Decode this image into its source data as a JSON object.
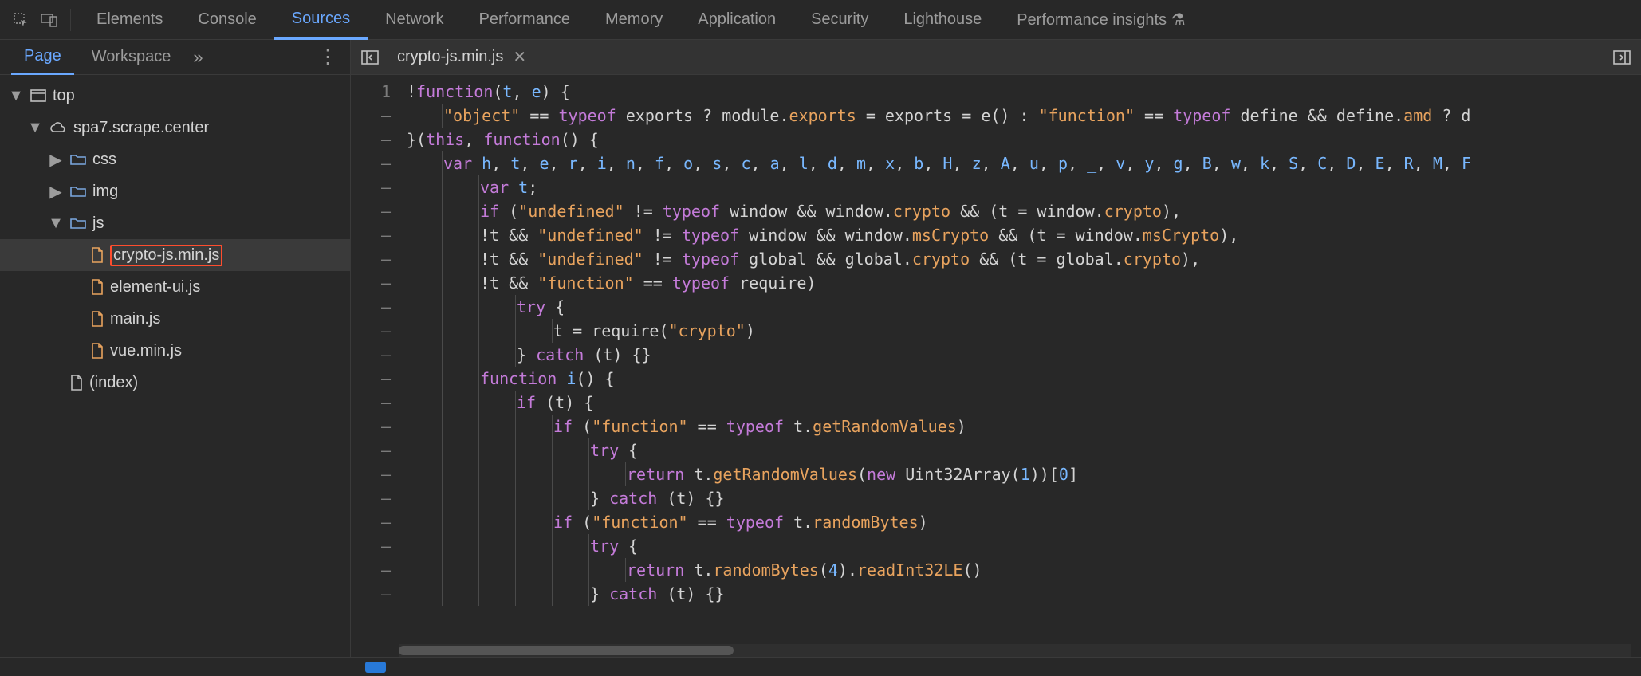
{
  "toolbar": {
    "tabs": [
      "Elements",
      "Console",
      "Sources",
      "Network",
      "Performance",
      "Memory",
      "Application",
      "Security",
      "Lighthouse",
      "Performance insights ⚗"
    ],
    "active_index": 2
  },
  "left_panel": {
    "subtabs": [
      "Page",
      "Workspace"
    ],
    "active_index": 0
  },
  "open_file_tab": "crypto-js.min.js",
  "tree": {
    "root": "top",
    "domain": "spa7.scrape.center",
    "folders": [
      {
        "name": "css",
        "open": false
      },
      {
        "name": "img",
        "open": false
      },
      {
        "name": "js",
        "open": true,
        "files": [
          "crypto-js.min.js",
          "element-ui.js",
          "main.js",
          "vue.min.js"
        ]
      }
    ],
    "index_label": "(index)",
    "selected_file": "crypto-js.min.js"
  },
  "gutter": [
    "1",
    "–",
    "–",
    "–",
    "–",
    "–",
    "–",
    "–",
    "–",
    "–",
    "–",
    "–",
    "–",
    "–",
    "–",
    "–",
    "–",
    "–",
    "–",
    "–",
    "–",
    "–"
  ],
  "code_lines": [
    {
      "indent": 0,
      "tokens": [
        [
          "op",
          "!"
        ],
        [
          "kw",
          "function"
        ],
        [
          "p",
          "("
        ],
        [
          "def",
          "t"
        ],
        [
          "p",
          ", "
        ],
        [
          "def",
          "e"
        ],
        [
          "p",
          ") {"
        ]
      ]
    },
    {
      "indent": 1,
      "tokens": [
        [
          "str",
          "\"object\""
        ],
        [
          "p",
          " == "
        ],
        [
          "kw",
          "typeof"
        ],
        [
          "p",
          " exports ? module."
        ],
        [
          "prop",
          "exports"
        ],
        [
          "p",
          " = exports = e() : "
        ],
        [
          "str",
          "\"function\""
        ],
        [
          "p",
          " == "
        ],
        [
          "kw",
          "typeof"
        ],
        [
          "p",
          " define && define."
        ],
        [
          "prop",
          "amd"
        ],
        [
          "p",
          " ? d"
        ]
      ]
    },
    {
      "indent": 0,
      "tokens": [
        [
          "p",
          "}("
        ],
        [
          "kw",
          "this"
        ],
        [
          "p",
          ", "
        ],
        [
          "kw",
          "function"
        ],
        [
          "p",
          "() {"
        ]
      ]
    },
    {
      "indent": 1,
      "tokens": [
        [
          "kw",
          "var"
        ],
        [
          "p",
          " "
        ],
        [
          "def",
          "h"
        ],
        [
          "p",
          ", "
        ],
        [
          "def",
          "t"
        ],
        [
          "p",
          ", "
        ],
        [
          "def",
          "e"
        ],
        [
          "p",
          ", "
        ],
        [
          "def",
          "r"
        ],
        [
          "p",
          ", "
        ],
        [
          "def",
          "i"
        ],
        [
          "p",
          ", "
        ],
        [
          "def",
          "n"
        ],
        [
          "p",
          ", "
        ],
        [
          "def",
          "f"
        ],
        [
          "p",
          ", "
        ],
        [
          "def",
          "o"
        ],
        [
          "p",
          ", "
        ],
        [
          "def",
          "s"
        ],
        [
          "p",
          ", "
        ],
        [
          "def",
          "c"
        ],
        [
          "p",
          ", "
        ],
        [
          "def",
          "a"
        ],
        [
          "p",
          ", "
        ],
        [
          "def",
          "l"
        ],
        [
          "p",
          ", "
        ],
        [
          "def",
          "d"
        ],
        [
          "p",
          ", "
        ],
        [
          "def",
          "m"
        ],
        [
          "p",
          ", "
        ],
        [
          "def",
          "x"
        ],
        [
          "p",
          ", "
        ],
        [
          "def",
          "b"
        ],
        [
          "p",
          ", "
        ],
        [
          "def",
          "H"
        ],
        [
          "p",
          ", "
        ],
        [
          "def",
          "z"
        ],
        [
          "p",
          ", "
        ],
        [
          "def",
          "A"
        ],
        [
          "p",
          ", "
        ],
        [
          "def",
          "u"
        ],
        [
          "p",
          ", "
        ],
        [
          "def",
          "p"
        ],
        [
          "p",
          ", "
        ],
        [
          "def",
          "_"
        ],
        [
          "p",
          ", "
        ],
        [
          "def",
          "v"
        ],
        [
          "p",
          ", "
        ],
        [
          "def",
          "y"
        ],
        [
          "p",
          ", "
        ],
        [
          "def",
          "g"
        ],
        [
          "p",
          ", "
        ],
        [
          "def",
          "B"
        ],
        [
          "p",
          ", "
        ],
        [
          "def",
          "w"
        ],
        [
          "p",
          ", "
        ],
        [
          "def",
          "k"
        ],
        [
          "p",
          ", "
        ],
        [
          "def",
          "S"
        ],
        [
          "p",
          ", "
        ],
        [
          "def",
          "C"
        ],
        [
          "p",
          ", "
        ],
        [
          "def",
          "D"
        ],
        [
          "p",
          ", "
        ],
        [
          "def",
          "E"
        ],
        [
          "p",
          ", "
        ],
        [
          "def",
          "R"
        ],
        [
          "p",
          ", "
        ],
        [
          "def",
          "M"
        ],
        [
          "p",
          ", "
        ],
        [
          "def",
          "F"
        ]
      ]
    },
    {
      "indent": 2,
      "tokens": [
        [
          "kw",
          "var"
        ],
        [
          "p",
          " "
        ],
        [
          "def",
          "t"
        ],
        [
          "p",
          ";"
        ]
      ]
    },
    {
      "indent": 2,
      "tokens": [
        [
          "kw",
          "if"
        ],
        [
          "p",
          " ("
        ],
        [
          "str",
          "\"undefined\""
        ],
        [
          "p",
          " != "
        ],
        [
          "kw",
          "typeof"
        ],
        [
          "p",
          " window && window."
        ],
        [
          "prop",
          "crypto"
        ],
        [
          "p",
          " && (t = window."
        ],
        [
          "prop",
          "crypto"
        ],
        [
          "p",
          "),"
        ]
      ]
    },
    {
      "indent": 2,
      "tokens": [
        [
          "p",
          "!t && "
        ],
        [
          "str",
          "\"undefined\""
        ],
        [
          "p",
          " != "
        ],
        [
          "kw",
          "typeof"
        ],
        [
          "p",
          " window && window."
        ],
        [
          "prop",
          "msCrypto"
        ],
        [
          "p",
          " && (t = window."
        ],
        [
          "prop",
          "msCrypto"
        ],
        [
          "p",
          "),"
        ]
      ]
    },
    {
      "indent": 2,
      "tokens": [
        [
          "p",
          "!t && "
        ],
        [
          "str",
          "\"undefined\""
        ],
        [
          "p",
          " != "
        ],
        [
          "kw",
          "typeof"
        ],
        [
          "p",
          " global && global."
        ],
        [
          "prop",
          "crypto"
        ],
        [
          "p",
          " && (t = global."
        ],
        [
          "prop",
          "crypto"
        ],
        [
          "p",
          "),"
        ]
      ]
    },
    {
      "indent": 2,
      "tokens": [
        [
          "p",
          "!t && "
        ],
        [
          "str",
          "\"function\""
        ],
        [
          "p",
          " == "
        ],
        [
          "kw",
          "typeof"
        ],
        [
          "p",
          " require)"
        ]
      ]
    },
    {
      "indent": 3,
      "tokens": [
        [
          "kw",
          "try"
        ],
        [
          "p",
          " {"
        ]
      ]
    },
    {
      "indent": 4,
      "tokens": [
        [
          "p",
          "t = require("
        ],
        [
          "str",
          "\"crypto\""
        ],
        [
          "p",
          ")"
        ]
      ]
    },
    {
      "indent": 3,
      "tokens": [
        [
          "p",
          "} "
        ],
        [
          "kw",
          "catch"
        ],
        [
          "p",
          " (t) {}"
        ]
      ]
    },
    {
      "indent": 2,
      "tokens": [
        [
          "kw",
          "function"
        ],
        [
          "p",
          " "
        ],
        [
          "def",
          "i"
        ],
        [
          "p",
          "() {"
        ]
      ]
    },
    {
      "indent": 3,
      "tokens": [
        [
          "kw",
          "if"
        ],
        [
          "p",
          " (t) {"
        ]
      ]
    },
    {
      "indent": 4,
      "tokens": [
        [
          "kw",
          "if"
        ],
        [
          "p",
          " ("
        ],
        [
          "str",
          "\"function\""
        ],
        [
          "p",
          " == "
        ],
        [
          "kw",
          "typeof"
        ],
        [
          "p",
          " t."
        ],
        [
          "prop",
          "getRandomValues"
        ],
        [
          "p",
          ")"
        ]
      ]
    },
    {
      "indent": 5,
      "tokens": [
        [
          "kw",
          "try"
        ],
        [
          "p",
          " {"
        ]
      ]
    },
    {
      "indent": 6,
      "tokens": [
        [
          "kw",
          "return"
        ],
        [
          "p",
          " t."
        ],
        [
          "prop",
          "getRandomValues"
        ],
        [
          "p",
          "("
        ],
        [
          "kw",
          "new"
        ],
        [
          "p",
          " Uint32Array("
        ],
        [
          "num",
          "1"
        ],
        [
          "p",
          "))["
        ],
        [
          "num",
          "0"
        ],
        [
          "p",
          "]"
        ]
      ]
    },
    {
      "indent": 5,
      "tokens": [
        [
          "p",
          "} "
        ],
        [
          "kw",
          "catch"
        ],
        [
          "p",
          " (t) {}"
        ]
      ]
    },
    {
      "indent": 4,
      "tokens": [
        [
          "kw",
          "if"
        ],
        [
          "p",
          " ("
        ],
        [
          "str",
          "\"function\""
        ],
        [
          "p",
          " == "
        ],
        [
          "kw",
          "typeof"
        ],
        [
          "p",
          " t."
        ],
        [
          "prop",
          "randomBytes"
        ],
        [
          "p",
          ")"
        ]
      ]
    },
    {
      "indent": 5,
      "tokens": [
        [
          "kw",
          "try"
        ],
        [
          "p",
          " {"
        ]
      ]
    },
    {
      "indent": 6,
      "tokens": [
        [
          "kw",
          "return"
        ],
        [
          "p",
          " t."
        ],
        [
          "prop",
          "randomBytes"
        ],
        [
          "p",
          "("
        ],
        [
          "num",
          "4"
        ],
        [
          "p",
          ")."
        ],
        [
          "prop",
          "readInt32LE"
        ],
        [
          "p",
          "()"
        ]
      ]
    },
    {
      "indent": 5,
      "tokens": [
        [
          "p",
          "} "
        ],
        [
          "kw",
          "catch"
        ],
        [
          "p",
          " (t) {}"
        ]
      ]
    }
  ]
}
